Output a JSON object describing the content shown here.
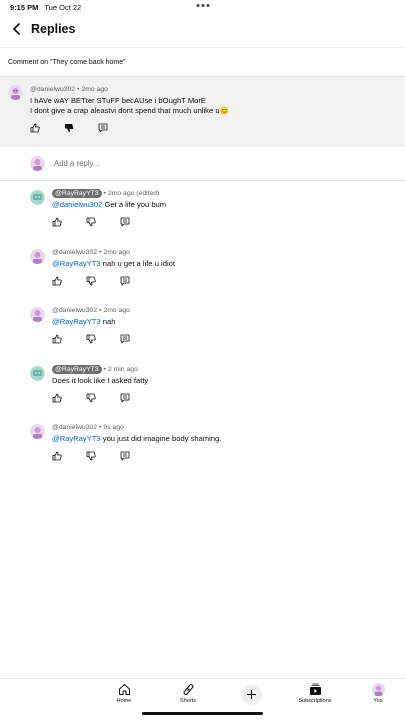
{
  "status": {
    "time": "9:15 PM",
    "date": "Tue Oct 22"
  },
  "header": {
    "title": "Replies"
  },
  "context": {
    "label": "Comment on “They come back home”"
  },
  "parent": {
    "author": "@danielwu302",
    "age": "2mo ago",
    "line1": "I hAVe wAY BETter STuFF becAUse i bOughT MorE",
    "line2": "I dont give a crap aleastvi dont spend that much unlike u",
    "emoji": "😊"
  },
  "add_reply": {
    "placeholder": "Add a reply..."
  },
  "replies": [
    {
      "author": "@RayRayYT3",
      "age": "2mo ago (edited)",
      "mention": "@danielwu302",
      "text": " Get a life you bum"
    },
    {
      "author": "@danielwu302",
      "age": "2mo ago",
      "mention": "@RayRayYT3",
      "text": " nah u get a life u idiot"
    },
    {
      "author": "@danielwu302",
      "age": "2mo ago",
      "mention": "@RayRayYT3",
      "text": " nah"
    },
    {
      "author": "@RayRayYT3",
      "age": "2 min ago",
      "mention": "",
      "text": "Does it look like I asked fatty"
    },
    {
      "author": "@danielwu302",
      "age": "0s ago",
      "mention": "@RayRayYT3",
      "text": " you just did imagine body shaming."
    }
  ],
  "nav": {
    "home": "Home",
    "shorts": "Shorts",
    "subscriptions": "Subscriptions",
    "you": "You"
  },
  "colors": {
    "mention": "#065fd4",
    "badge": "#6f6f6f",
    "parent_bg": "#f2f2f2"
  }
}
